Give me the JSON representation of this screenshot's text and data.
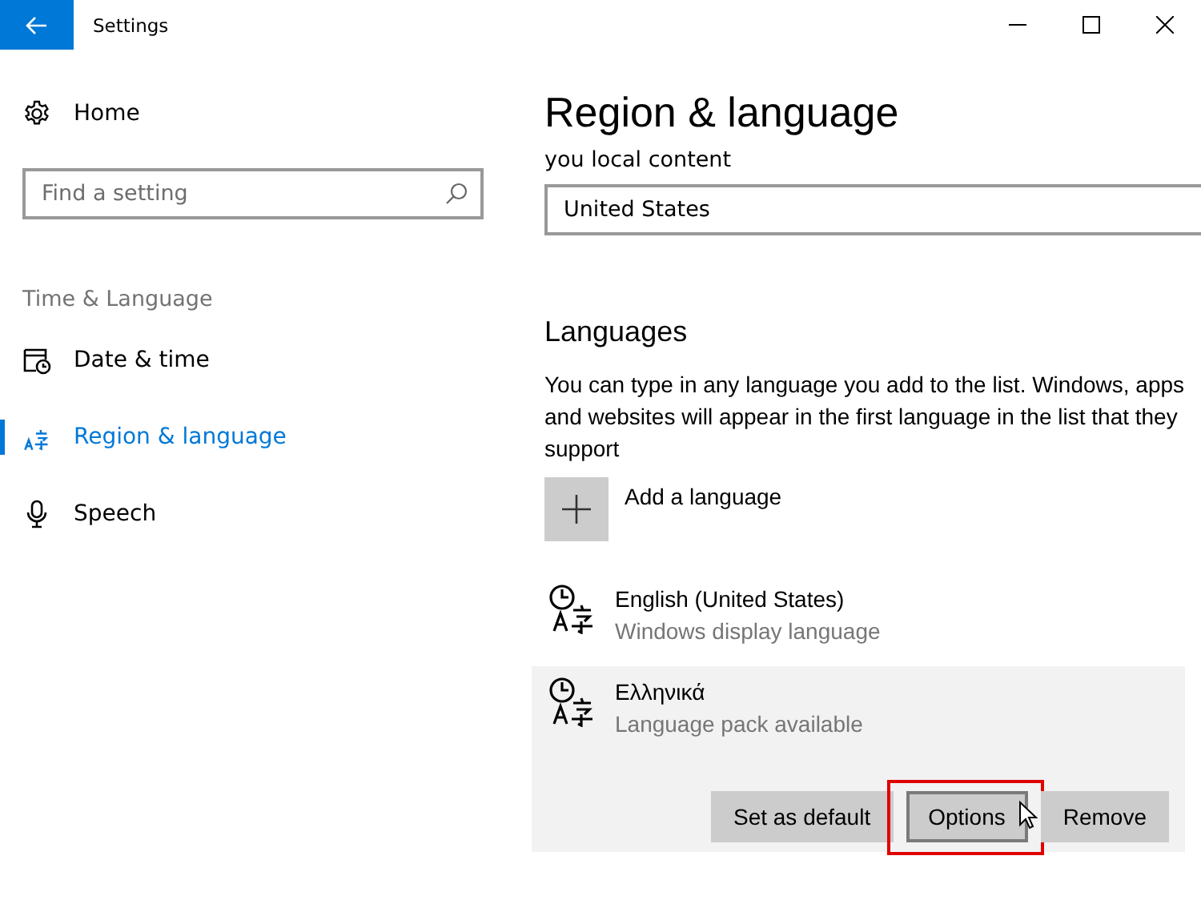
{
  "window": {
    "title": "Settings"
  },
  "sidebar": {
    "home": "Home",
    "search": {
      "placeholder": "Find a setting"
    },
    "section": "Time & Language",
    "items": [
      {
        "label": "Date & time",
        "kind": "calendar",
        "selected": false
      },
      {
        "label": "Region & language",
        "kind": "language",
        "selected": true
      },
      {
        "label": "Speech",
        "kind": "mic",
        "selected": false
      }
    ]
  },
  "page": {
    "title": "Region & language",
    "region_caption": "you local content",
    "country": {
      "value": "United States"
    },
    "languages_heading": "Languages",
    "languages_text": "You can type in any language you add to the list. Windows, apps and websites will appear in the first language in the list that they support",
    "add_language": "Add a language",
    "languages": [
      {
        "name": "English (United States)",
        "status": "Windows display language",
        "selected": false
      },
      {
        "name": "Ελληνικά",
        "status": "Language pack available",
        "selected": true
      }
    ],
    "buttons": [
      {
        "label": "Set as default",
        "highlighted": false
      },
      {
        "label": "Options",
        "highlighted": true
      },
      {
        "label": "Remove",
        "highlighted": false
      }
    ]
  }
}
